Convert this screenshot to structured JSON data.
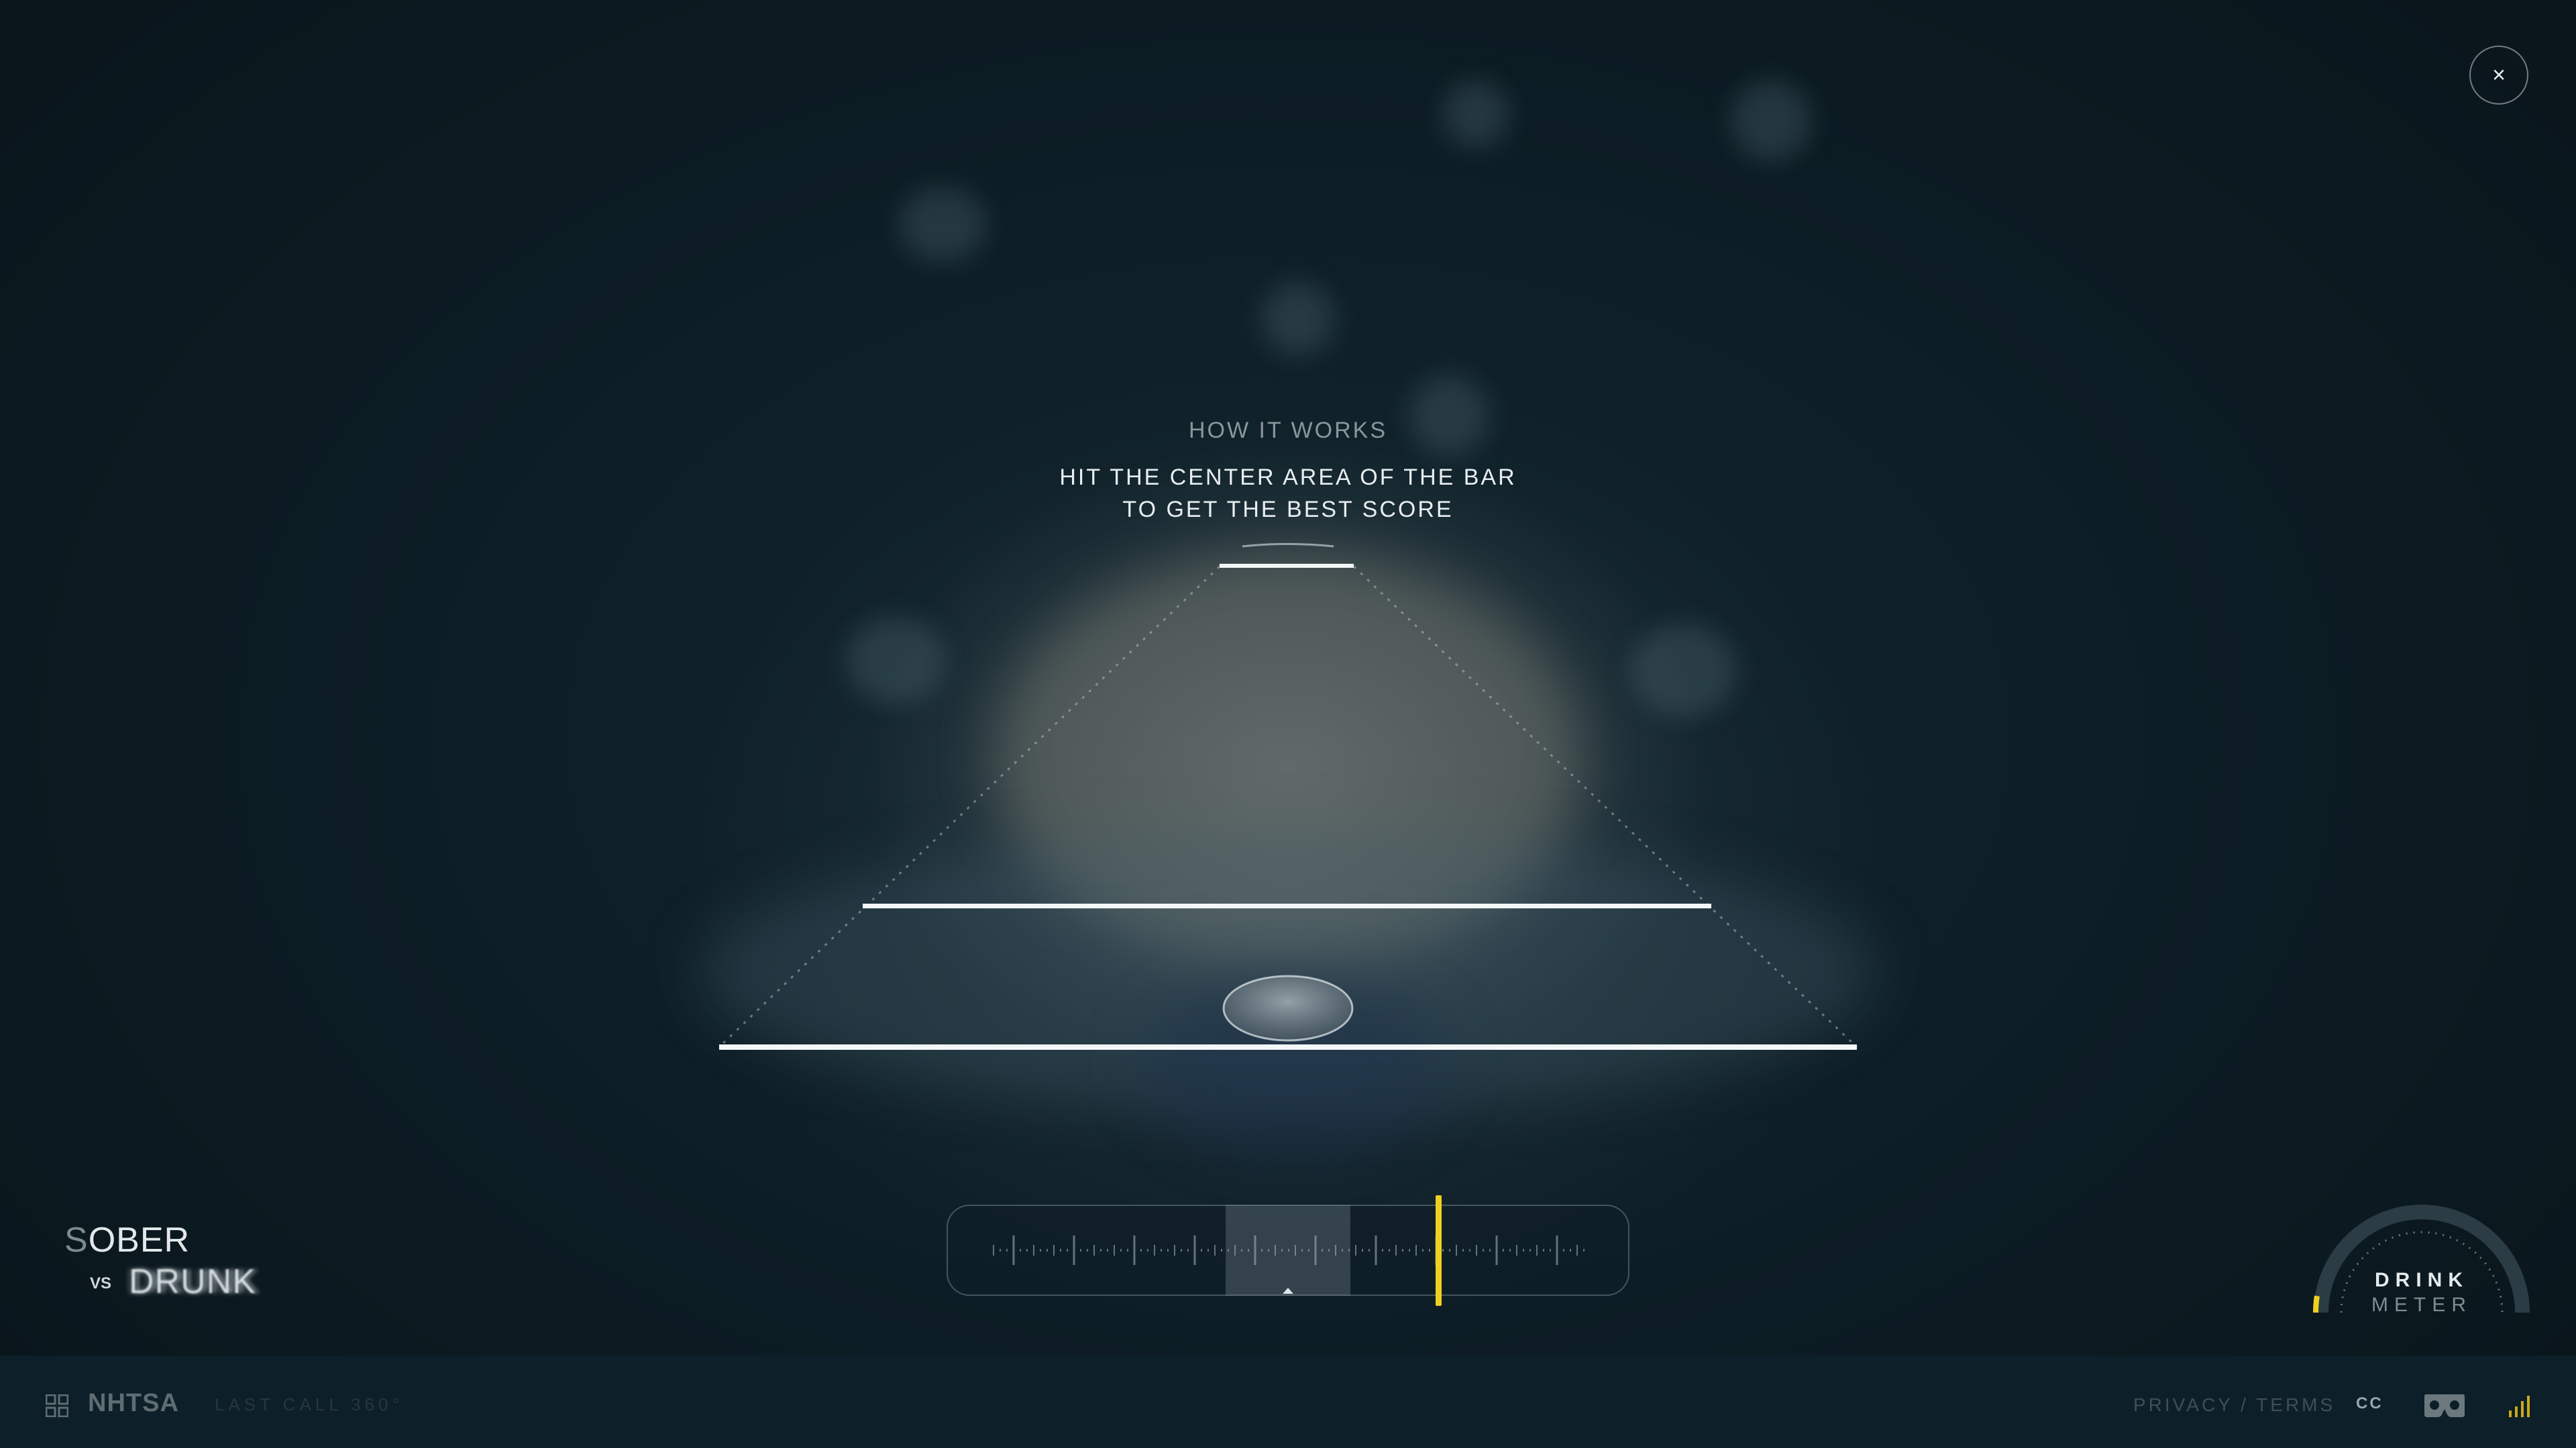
{
  "header": {
    "title": "HOW IT WORKS",
    "instruction_line1": "HIT THE CENTER AREA OF THE BAR",
    "instruction_line2": "TO GET THE BEST SCORE"
  },
  "close_button": {
    "label": "×"
  },
  "logo": {
    "sober": "SOBER",
    "vs": "VS",
    "drunk": "DRUNK"
  },
  "drink_meter": {
    "label_line1": "DRINK",
    "label_line2": "METER",
    "level": 0.05
  },
  "slider": {
    "indicator_position": 0.72,
    "target_zone": "center"
  },
  "footer": {
    "brand": "NHTSA",
    "subtitle": "LAST CALL 360°",
    "privacy_terms": "PRIVACY / TERMS",
    "cc": "CC",
    "vr_icon": "cardboard-vr-icon",
    "sound_icon": "sound-bars-icon",
    "grid_icon": "grid-menu-icon"
  },
  "colors": {
    "accent": "#f1cf22",
    "background": "#0b1a22",
    "text_primary": "#e8eef0",
    "text_muted": "#8a969b"
  }
}
